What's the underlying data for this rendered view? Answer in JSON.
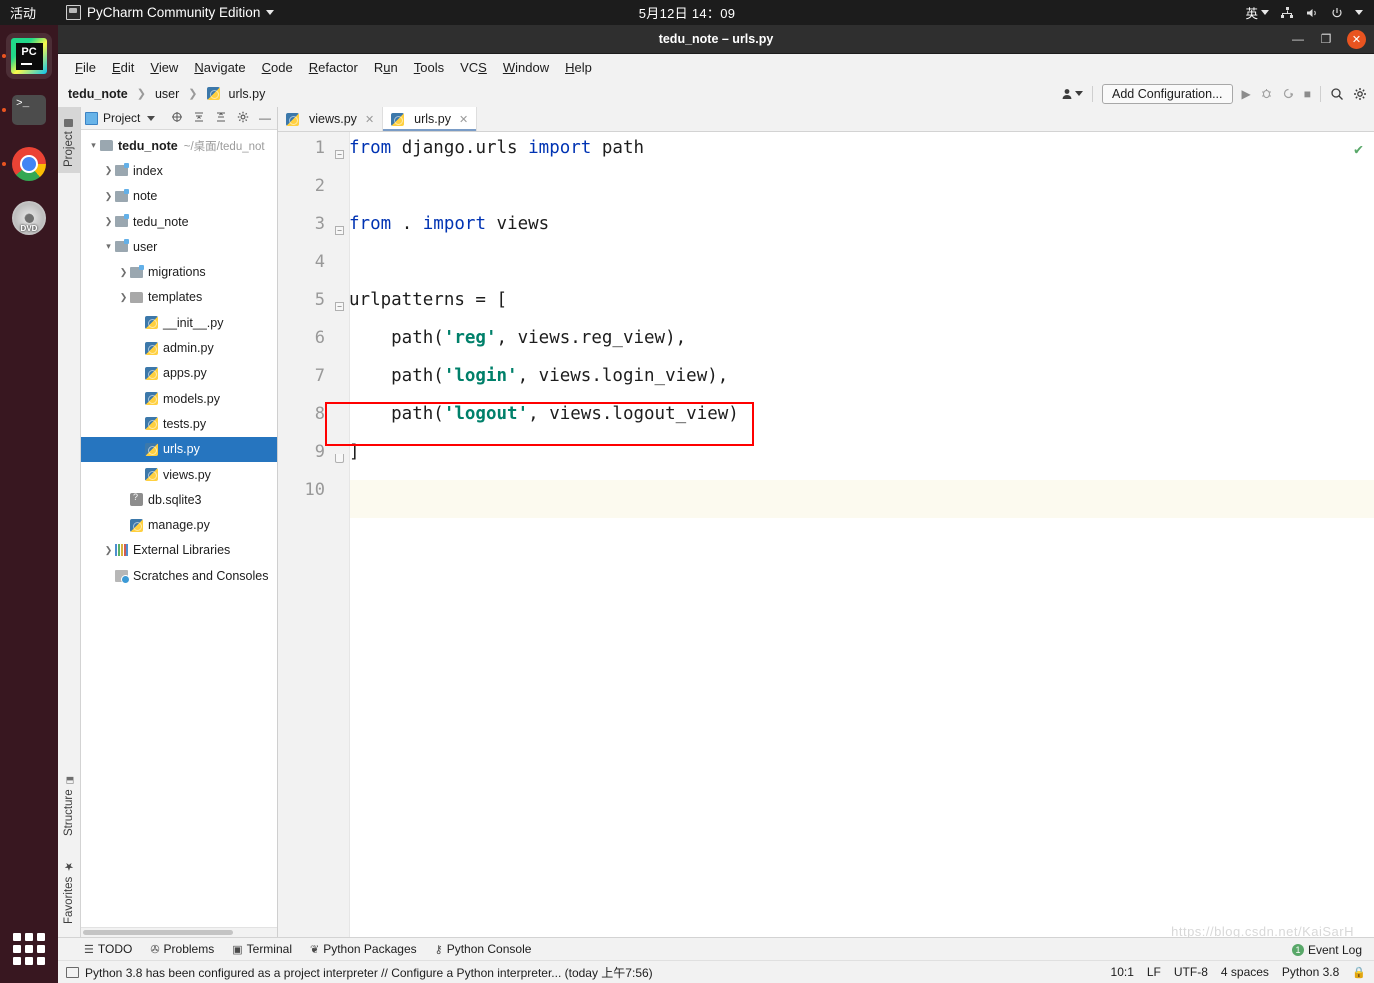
{
  "desktop": {
    "activities": "活动",
    "app_menu": "PyCharm Community Edition",
    "clock": "5月12日 14：09",
    "tray": {
      "input": "英",
      "network_icon": "network-icon",
      "volume_icon": "volume-icon",
      "power_icon": "power-icon"
    },
    "dock": [
      {
        "name": "pycharm",
        "label": "PC",
        "running": true
      },
      {
        "name": "terminal",
        "label": ">_",
        "running": true
      },
      {
        "name": "chrome",
        "label": "",
        "running": true
      },
      {
        "name": "dvd",
        "label": "DVD",
        "running": false
      }
    ]
  },
  "window": {
    "title": "tedu_note – urls.py",
    "controls": {
      "minimize": "—",
      "maximize": "❐",
      "close": "✕"
    }
  },
  "menu": [
    {
      "label": "File",
      "mn": "F"
    },
    {
      "label": "Edit",
      "mn": "E"
    },
    {
      "label": "View",
      "mn": "V"
    },
    {
      "label": "Navigate",
      "mn": "N"
    },
    {
      "label": "Code",
      "mn": "C"
    },
    {
      "label": "Refactor",
      "mn": "R"
    },
    {
      "label": "Run",
      "mn": "u"
    },
    {
      "label": "Tools",
      "mn": "T"
    },
    {
      "label": "VCS",
      "mn": "S"
    },
    {
      "label": "Window",
      "mn": "W"
    },
    {
      "label": "Help",
      "mn": "H"
    }
  ],
  "navbar": {
    "breadcrumb": [
      "tedu_note",
      "user",
      "urls.py"
    ],
    "run_config_label": "Add Configuration...",
    "icons": [
      "user-profile-icon",
      "run-icon",
      "debug-icon",
      "run-coverage-icon",
      "stop-icon",
      "search-icon",
      "settings-gear-icon"
    ]
  },
  "tool_tabs": {
    "left_top": "Project",
    "left_bottom": [
      "Structure",
      "Favorites"
    ]
  },
  "project_panel": {
    "title": "Project",
    "toolbar_icons": [
      "locate-icon",
      "collapse-all-icon",
      "expand-all-icon",
      "settings-gear-icon",
      "hide-icon"
    ],
    "tree": [
      {
        "label": "tedu_note",
        "path": "~/桌面/tedu_not",
        "indent": 0,
        "arrow": "v",
        "icon": "folder-root",
        "bold": true,
        "selected": false
      },
      {
        "label": "index",
        "path": "",
        "indent": 1,
        "arrow": ">",
        "icon": "folder-src",
        "bold": false,
        "selected": false
      },
      {
        "label": "note",
        "path": "",
        "indent": 1,
        "arrow": ">",
        "icon": "folder-src",
        "bold": false,
        "selected": false
      },
      {
        "label": "tedu_note",
        "path": "",
        "indent": 1,
        "arrow": ">",
        "icon": "folder-src",
        "bold": false,
        "selected": false
      },
      {
        "label": "user",
        "path": "",
        "indent": 1,
        "arrow": "v",
        "icon": "folder-src",
        "bold": false,
        "selected": false
      },
      {
        "label": "migrations",
        "path": "",
        "indent": 2,
        "arrow": ">",
        "icon": "folder-src",
        "bold": false,
        "selected": false
      },
      {
        "label": "templates",
        "path": "",
        "indent": 2,
        "arrow": ">",
        "icon": "folder",
        "bold": false,
        "selected": false
      },
      {
        "label": "__init__.py",
        "path": "",
        "indent": 3,
        "arrow": "",
        "icon": "python-file",
        "bold": false,
        "selected": false
      },
      {
        "label": "admin.py",
        "path": "",
        "indent": 3,
        "arrow": "",
        "icon": "python-file",
        "bold": false,
        "selected": false
      },
      {
        "label": "apps.py",
        "path": "",
        "indent": 3,
        "arrow": "",
        "icon": "python-file",
        "bold": false,
        "selected": false
      },
      {
        "label": "models.py",
        "path": "",
        "indent": 3,
        "arrow": "",
        "icon": "python-file",
        "bold": false,
        "selected": false
      },
      {
        "label": "tests.py",
        "path": "",
        "indent": 3,
        "arrow": "",
        "icon": "python-file",
        "bold": false,
        "selected": false
      },
      {
        "label": "urls.py",
        "path": "",
        "indent": 3,
        "arrow": "",
        "icon": "python-file",
        "bold": false,
        "selected": true
      },
      {
        "label": "views.py",
        "path": "",
        "indent": 3,
        "arrow": "",
        "icon": "python-file",
        "bold": false,
        "selected": false
      },
      {
        "label": "db.sqlite3",
        "path": "",
        "indent": 2,
        "arrow": "",
        "icon": "db-file",
        "bold": false,
        "selected": false
      },
      {
        "label": "manage.py",
        "path": "",
        "indent": 2,
        "arrow": "",
        "icon": "python-file",
        "bold": false,
        "selected": false
      },
      {
        "label": "External Libraries",
        "path": "",
        "indent": 1,
        "arrow": ">",
        "icon": "library",
        "bold": false,
        "selected": false
      },
      {
        "label": "Scratches and Consoles",
        "path": "",
        "indent": 1,
        "arrow": "",
        "icon": "scratch",
        "bold": false,
        "selected": false
      }
    ]
  },
  "editor": {
    "tabs": [
      {
        "label": "views.py",
        "active": false
      },
      {
        "label": "urls.py",
        "active": true
      }
    ],
    "inspection_status": "✔",
    "lines": [
      {
        "n": "1",
        "segments": [
          {
            "t": "from ",
            "c": "kw"
          },
          {
            "t": "django.urls ",
            "c": ""
          },
          {
            "t": "import ",
            "c": "kw"
          },
          {
            "t": "path",
            "c": ""
          }
        ]
      },
      {
        "n": "2",
        "segments": []
      },
      {
        "n": "3",
        "segments": [
          {
            "t": "from ",
            "c": "kw"
          },
          {
            "t": ". ",
            "c": ""
          },
          {
            "t": "import ",
            "c": "kw"
          },
          {
            "t": "views",
            "c": ""
          }
        ]
      },
      {
        "n": "4",
        "segments": []
      },
      {
        "n": "5",
        "segments": [
          {
            "t": "urlpatterns = [",
            "c": ""
          }
        ]
      },
      {
        "n": "6",
        "segments": [
          {
            "t": "    path(",
            "c": ""
          },
          {
            "t": "'reg'",
            "c": "str"
          },
          {
            "t": ", views.reg_view),",
            "c": ""
          }
        ]
      },
      {
        "n": "7",
        "segments": [
          {
            "t": "    path(",
            "c": ""
          },
          {
            "t": "'login'",
            "c": "str"
          },
          {
            "t": ", views.login_view),",
            "c": ""
          }
        ]
      },
      {
        "n": "8",
        "segments": [
          {
            "t": "    path(",
            "c": ""
          },
          {
            "t": "'logout'",
            "c": "str"
          },
          {
            "t": ", views.logout_view)",
            "c": ""
          }
        ]
      },
      {
        "n": "9",
        "segments": [
          {
            "t": "]",
            "c": ""
          }
        ]
      },
      {
        "n": "10",
        "segments": []
      }
    ],
    "annotation": {
      "type": "red-rectangle",
      "target_line": "8"
    },
    "watermark": "https://blog.csdn.net/KaiSarH"
  },
  "bottom_tool_bar": [
    {
      "label": "TODO",
      "icon": "list-icon"
    },
    {
      "label": "Problems",
      "icon": "problems-icon"
    },
    {
      "label": "Terminal",
      "icon": "terminal-icon"
    },
    {
      "label": "Python Packages",
      "icon": "packages-icon"
    },
    {
      "label": "Python Console",
      "icon": "console-icon"
    }
  ],
  "status_bar": {
    "message": "Python 3.8 has been configured as a project interpreter // Configure a Python interpreter... (today 上午7:56)",
    "event_log": "Event Log",
    "event_count": "1",
    "caret": "10:1",
    "line_sep": "LF",
    "encoding": "UTF-8",
    "indent": "4 spaces",
    "interpreter": "Python 3.8",
    "lock_icon": "lock-icon"
  }
}
